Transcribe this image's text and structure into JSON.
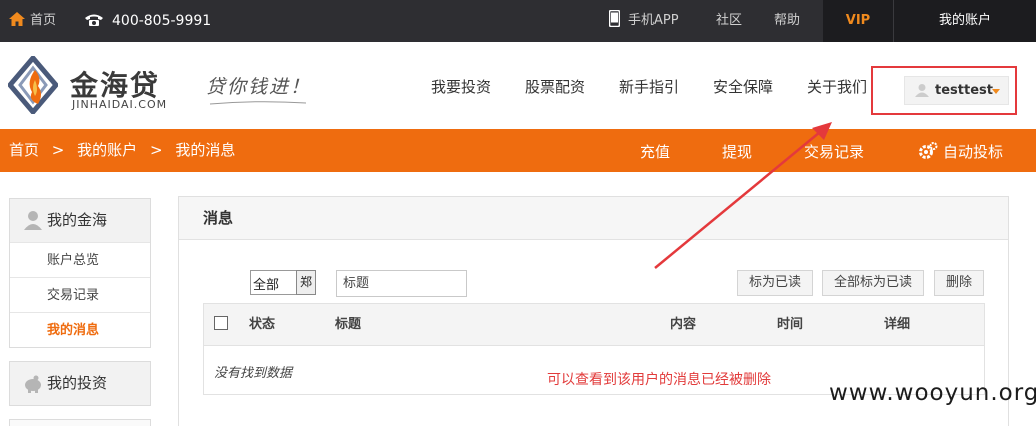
{
  "topbar": {
    "home": "首页",
    "phone": "400-805-9991",
    "app": "手机APP",
    "community": "社区",
    "help": "帮助",
    "vip": "VIP",
    "account": "我的账户"
  },
  "header": {
    "brand": "金海贷",
    "brand_sub": "JINHAIDAI.COM",
    "slogan": "贷你钱进！",
    "nav": [
      "我要投资",
      "股票配资",
      "新手指引",
      "安全保障",
      "关于我们"
    ],
    "username": "testtest"
  },
  "orange_bar": {
    "breadcrumb": [
      "首页",
      ">",
      "我的账户",
      ">",
      "我的消息"
    ],
    "actions": [
      "充值",
      "提现",
      "交易记录",
      "自动投标"
    ]
  },
  "sidebar": {
    "group1_title": "我的金海",
    "group1_items": [
      "账户总览",
      "交易记录",
      "我的消息"
    ],
    "group2_title": "我的投资"
  },
  "main": {
    "title": "消息",
    "filter_value": "全部",
    "filter_arrow": "郑",
    "title_placeholder": "标题",
    "buttons": [
      "标为已读",
      "全部标为已读",
      "删除"
    ],
    "columns": [
      "状态",
      "标题",
      "内容",
      "时间",
      "详细"
    ],
    "empty_text": "没有找到数据",
    "annotation": "可以查看到该用户的消息已经被删除"
  },
  "watermark": "www.wooyun.org",
  "colors": {
    "orange": "#ef6c0f",
    "dark": "#2e2e32",
    "red": "#e4393c",
    "vip": "#f08a1e"
  }
}
